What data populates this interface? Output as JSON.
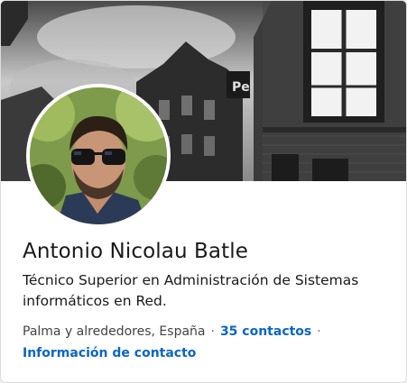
{
  "profile": {
    "name": "Antonio Nicolau Batle",
    "headline": "Técnico Superior en Administración de Sistemas informáticos en Red.",
    "location": "Palma y alrededores, España",
    "separator": "·",
    "connections_link": "35 contactos",
    "contact_info_link": "Información de contacto"
  },
  "cover": {
    "sign_text": "Pe"
  },
  "colors": {
    "link": "#0a66c2",
    "text_primary": "#191919",
    "card_background": "#ffffff"
  }
}
